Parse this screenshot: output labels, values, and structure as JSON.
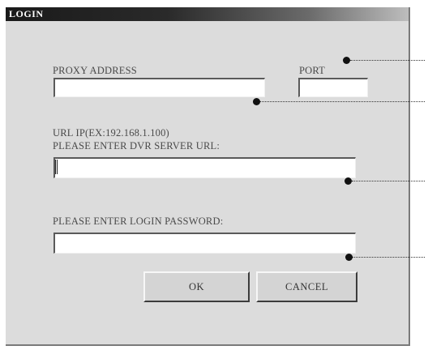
{
  "window": {
    "title": "LOGIN"
  },
  "proxy": {
    "label": "PROXY ADDRESS",
    "value": "",
    "placeholder": ""
  },
  "port": {
    "label": "PORT",
    "value": "",
    "placeholder": ""
  },
  "server_url": {
    "hint": "URL IP(EX:192.168.1.100)",
    "label": "PLEASE ENTER DVR SERVER URL:",
    "value": "",
    "placeholder": ""
  },
  "password": {
    "label": "PLEASE ENTER LOGIN PASSWORD:",
    "value": "",
    "placeholder": ""
  },
  "buttons": {
    "ok": "OK",
    "cancel": "CANCEL"
  },
  "colors": {
    "dialog_background": "#dcdcdc",
    "title_bar": "#1a1a1a",
    "callout_marker": "#111111"
  }
}
